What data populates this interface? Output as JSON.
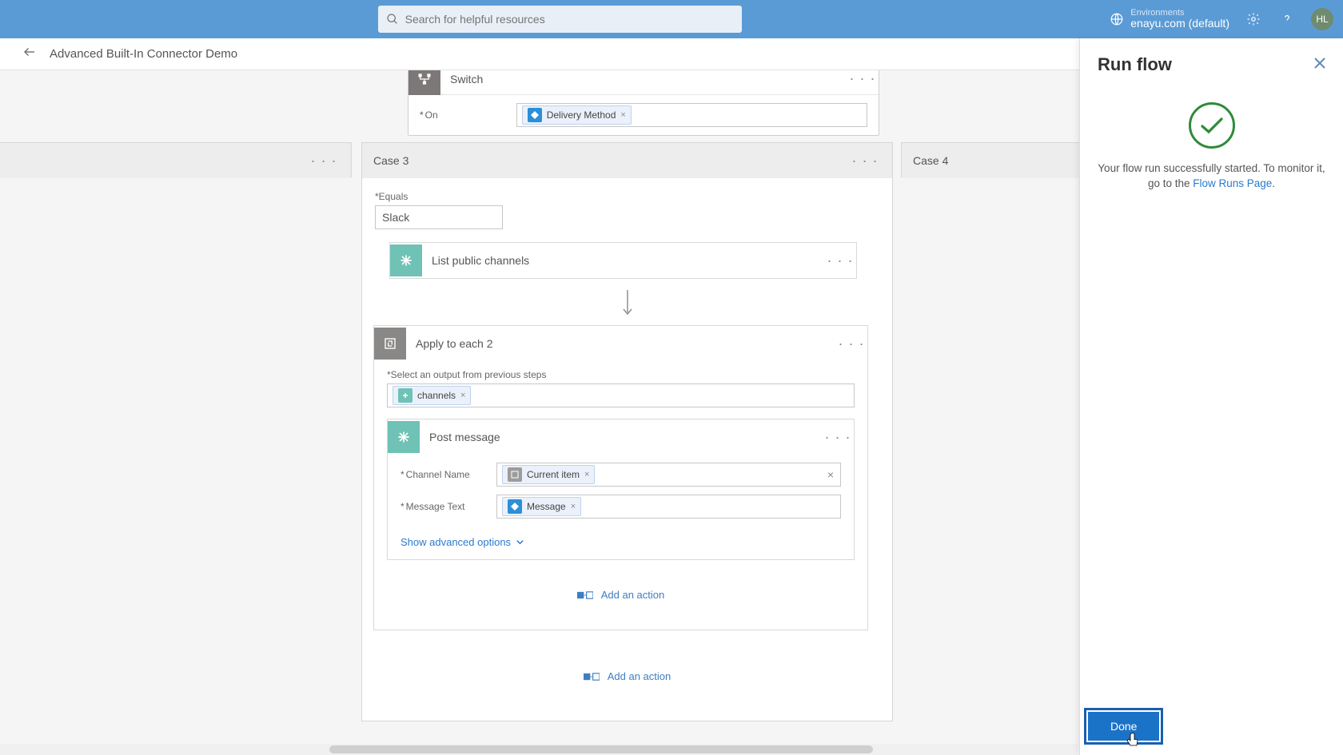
{
  "header": {
    "search_placeholder": "Search for helpful resources",
    "env_label": "Environments",
    "env_name": "enayu.com (default)",
    "avatar": "HL"
  },
  "breadcrumb": {
    "title": "Advanced Built-In Connector Demo"
  },
  "switch": {
    "title": "Switch",
    "on_label": "On",
    "on_token": "Delivery Method"
  },
  "cases": {
    "case3": {
      "title": "Case 3",
      "equals_label": "Equals",
      "equals_value": "Slack",
      "list_channels": "List public channels",
      "apply_each": "Apply to each 2",
      "select_output_label": "Select an output from previous steps",
      "channels_token": "channels",
      "post_message": {
        "title": "Post message",
        "channel_label": "Channel Name",
        "channel_token": "Current item",
        "text_label": "Message Text",
        "text_token": "Message",
        "advanced": "Show advanced options"
      },
      "add_action": "Add an action",
      "add_action_outer": "Add an action"
    },
    "case4": {
      "title": "Case 4"
    }
  },
  "panel": {
    "title": "Run flow",
    "msg_pre": "Your flow run successfully started. To monitor it, go to the ",
    "link": "Flow Runs Page",
    "msg_post": ".",
    "done": "Done"
  }
}
